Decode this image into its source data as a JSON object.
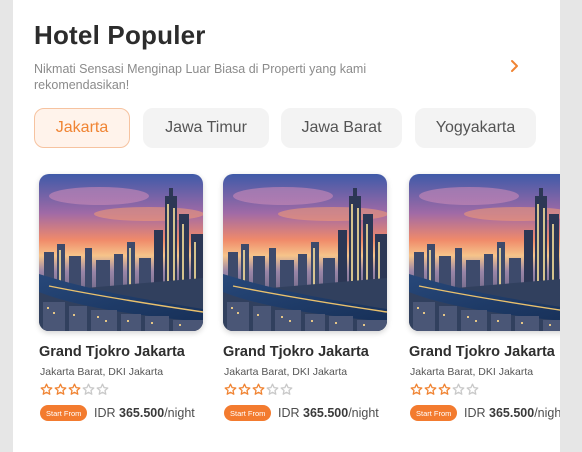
{
  "section": {
    "title": "Hotel Populer",
    "subtitle": "Nikmati Sensasi Menginap Luar Biasa di Properti yang kami rekomendasikan!"
  },
  "tabs": [
    {
      "label": "Jakarta",
      "active": true
    },
    {
      "label": "Jawa Timur",
      "active": false
    },
    {
      "label": "Jawa Barat",
      "active": false
    },
    {
      "label": "Yogyakarta",
      "active": false
    }
  ],
  "cards": [
    {
      "name": "Grand Tjokro Jakarta",
      "location": "Jakarta Barat, DKI Jakarta",
      "rating": 3,
      "max_rating": 5,
      "badge": "Start From",
      "currency": "IDR",
      "price": "365.500",
      "unit": "/night"
    },
    {
      "name": "Grand Tjokro Jakarta",
      "location": "Jakarta Barat, DKI Jakarta",
      "rating": 3,
      "max_rating": 5,
      "badge": "Start From",
      "currency": "IDR",
      "price": "365.500",
      "unit": "/night"
    },
    {
      "name": "Grand Tjokro Jakarta",
      "location": "Jakarta Barat, DKI Jakarta",
      "rating": 3,
      "max_rating": 5,
      "badge": "Start From",
      "currency": "IDR",
      "price": "365.500",
      "unit": "/nigh"
    }
  ],
  "colors": {
    "accent": "#f08433",
    "badge": "#f37b2f",
    "star": "#f08433"
  },
  "icons": {
    "more": "chevron-right-icon",
    "rating": "star-icon"
  }
}
